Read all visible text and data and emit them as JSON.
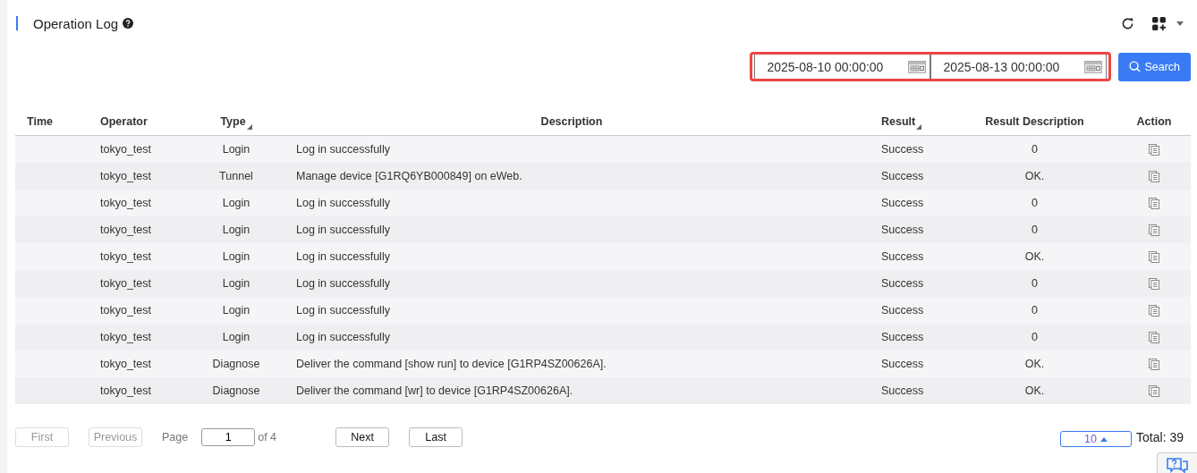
{
  "header": {
    "title": "Operation Log"
  },
  "filters": {
    "start_date": "2025-08-10 00:00:00",
    "end_date": "2025-08-13 00:00:00",
    "search_button": "Search"
  },
  "table": {
    "columns": [
      {
        "label": "Time",
        "sortable": false
      },
      {
        "label": "Operator",
        "sortable": false
      },
      {
        "label": "Type",
        "sortable": true
      },
      {
        "label": "Description",
        "sortable": false
      },
      {
        "label": "Result",
        "sortable": true
      },
      {
        "label": "Result Description",
        "sortable": false
      },
      {
        "label": "Action",
        "sortable": false
      }
    ],
    "rows": [
      {
        "operator": "tokyo_test",
        "type": "Login",
        "description": "Log in successfully",
        "result": "Success",
        "result_description": "0"
      },
      {
        "operator": "tokyo_test",
        "type": "Tunnel",
        "description": "Manage device [G1RQ6YB000849] on eWeb.",
        "result": "Success",
        "result_description": "OK."
      },
      {
        "operator": "tokyo_test",
        "type": "Login",
        "description": "Log in successfully",
        "result": "Success",
        "result_description": "0"
      },
      {
        "operator": "tokyo_test",
        "type": "Login",
        "description": "Log in successfully",
        "result": "Success",
        "result_description": "0"
      },
      {
        "operator": "tokyo_test",
        "type": "Login",
        "description": "Log in successfully",
        "result": "Success",
        "result_description": "OK."
      },
      {
        "operator": "tokyo_test",
        "type": "Login",
        "description": "Log in successfully",
        "result": "Success",
        "result_description": "0"
      },
      {
        "operator": "tokyo_test",
        "type": "Login",
        "description": "Log in successfully",
        "result": "Success",
        "result_description": "0"
      },
      {
        "operator": "tokyo_test",
        "type": "Login",
        "description": "Log in successfully",
        "result": "Success",
        "result_description": "0"
      },
      {
        "operator": "tokyo_test",
        "type": "Diagnose",
        "description": "Deliver the command [show run] to device [G1RP4SZ00626A].",
        "result": "Success",
        "result_description": "OK."
      },
      {
        "operator": "tokyo_test",
        "type": "Diagnose",
        "description": "Deliver the command [wr] to device [G1RP4SZ00626A].",
        "result": "Success",
        "result_description": "OK."
      }
    ]
  },
  "pagination": {
    "first": {
      "label": "First",
      "disabled": true
    },
    "previous": {
      "label": "Previous",
      "disabled": true
    },
    "page_label": "Page",
    "page": "1",
    "of_pages": "of 4",
    "next": {
      "label": "Next",
      "disabled": false
    },
    "last": {
      "label": "Last",
      "disabled": false
    },
    "page_size": "10",
    "total": "Total: 39"
  }
}
